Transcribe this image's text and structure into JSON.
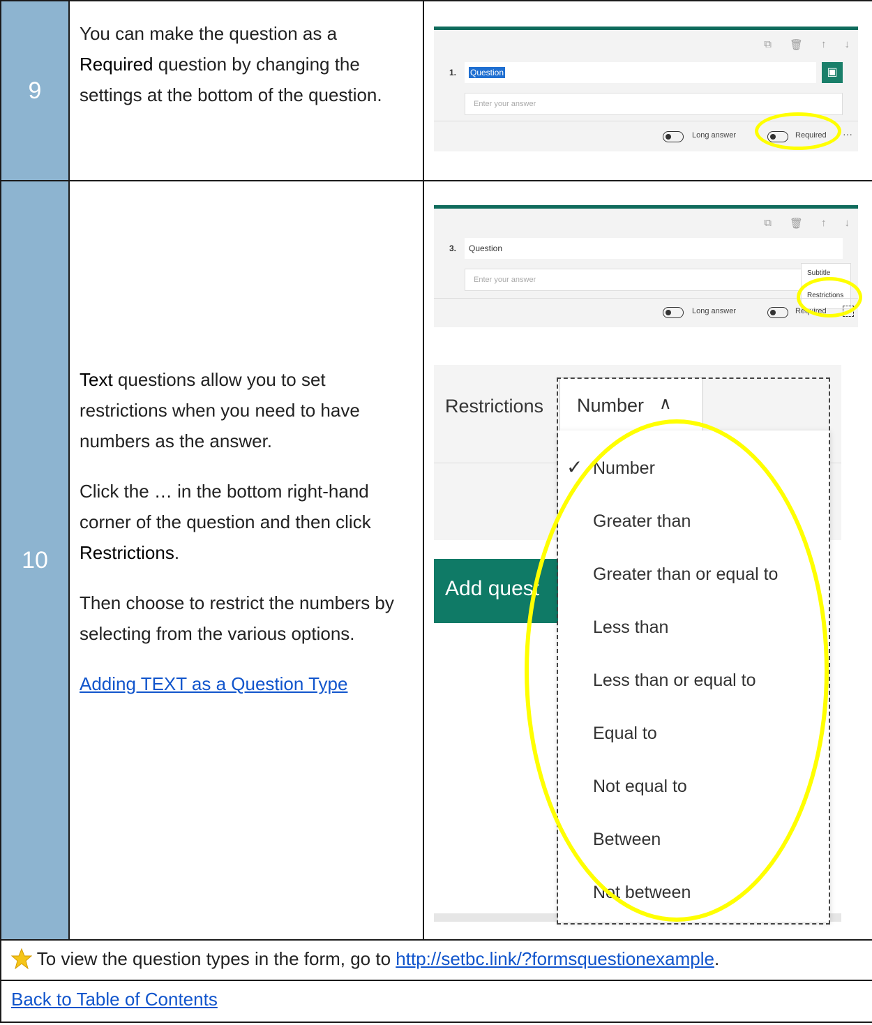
{
  "rows": [
    {
      "number": "9",
      "paragraphs": [
        {
          "pre": "You can make the question as a ",
          "bold": "Required",
          "post": " question by changing the settings at the bottom of the question."
        }
      ],
      "screenshot": {
        "question_number": "1.",
        "question_text": "Question",
        "answer_placeholder": "Enter your answer",
        "long_answer_label": "Long answer",
        "required_label": "Required",
        "more_label": "···"
      }
    },
    {
      "number": "10",
      "p1": {
        "bold": "Text",
        "post": " questions allow you to set restrictions when you need to have numbers as the answer."
      },
      "p2": {
        "pre": "Click the ",
        "bold": "…",
        "mid": " in the bottom right-hand corner of the question and then click ",
        "bold2": "Restrictions",
        "post": "."
      },
      "p3": "Then choose to restrict the numbers by selecting from the various options.",
      "link": "Adding TEXT as a Question Type",
      "screenshot_small": {
        "question_number": "3.",
        "question_text": "Question",
        "answer_placeholder": "Enter your answer",
        "menu_subtitle": "Subtitle",
        "menu_restrictions": "Restrictions",
        "long_answer_label": "Long answer",
        "required_label": "Required"
      },
      "screenshot_large": {
        "restrictions_label": "Restrictions",
        "selected": "Number",
        "add_question": "Add quest",
        "options": [
          "Number",
          "Greater than",
          "Greater than or equal to",
          "Less than",
          "Less than or equal to",
          "Equal to",
          "Not equal to",
          "Between",
          "Not between"
        ],
        "checkmark": "✓"
      }
    }
  ],
  "note": {
    "text": "To view the question types in the form, go to ",
    "url": "http://setbc.link/?formsquestionexample",
    "post": "."
  },
  "back_link": "Back to Table of Contents"
}
